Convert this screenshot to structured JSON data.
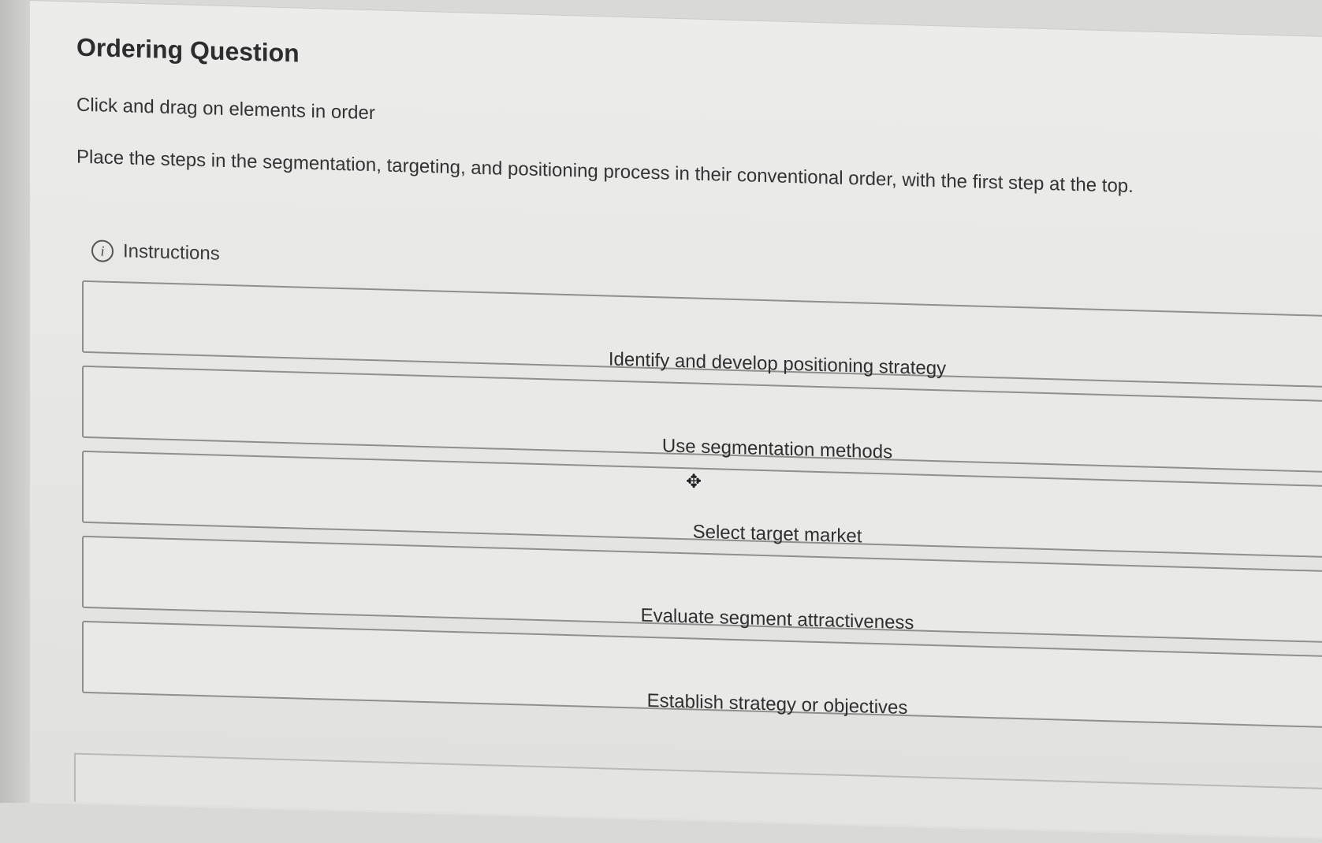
{
  "question": {
    "title": "Ordering Question",
    "subtitle": "Click and drag on elements in order",
    "prompt": "Place the steps in the segmentation, targeting, and positioning process in their conventional order, with the first step at the top.",
    "instructions_label": "Instructions",
    "info_icon_glyph": "i"
  },
  "order_items": [
    {
      "label": "Identify and develop positioning strategy"
    },
    {
      "label": "Use segmentation methods"
    },
    {
      "label": "Select target market"
    },
    {
      "label": "Evaluate segment attractiveness"
    },
    {
      "label": "Establish strategy or objectives"
    }
  ],
  "cursor": {
    "icon": "move-cursor-icon",
    "glyph": "✥"
  }
}
